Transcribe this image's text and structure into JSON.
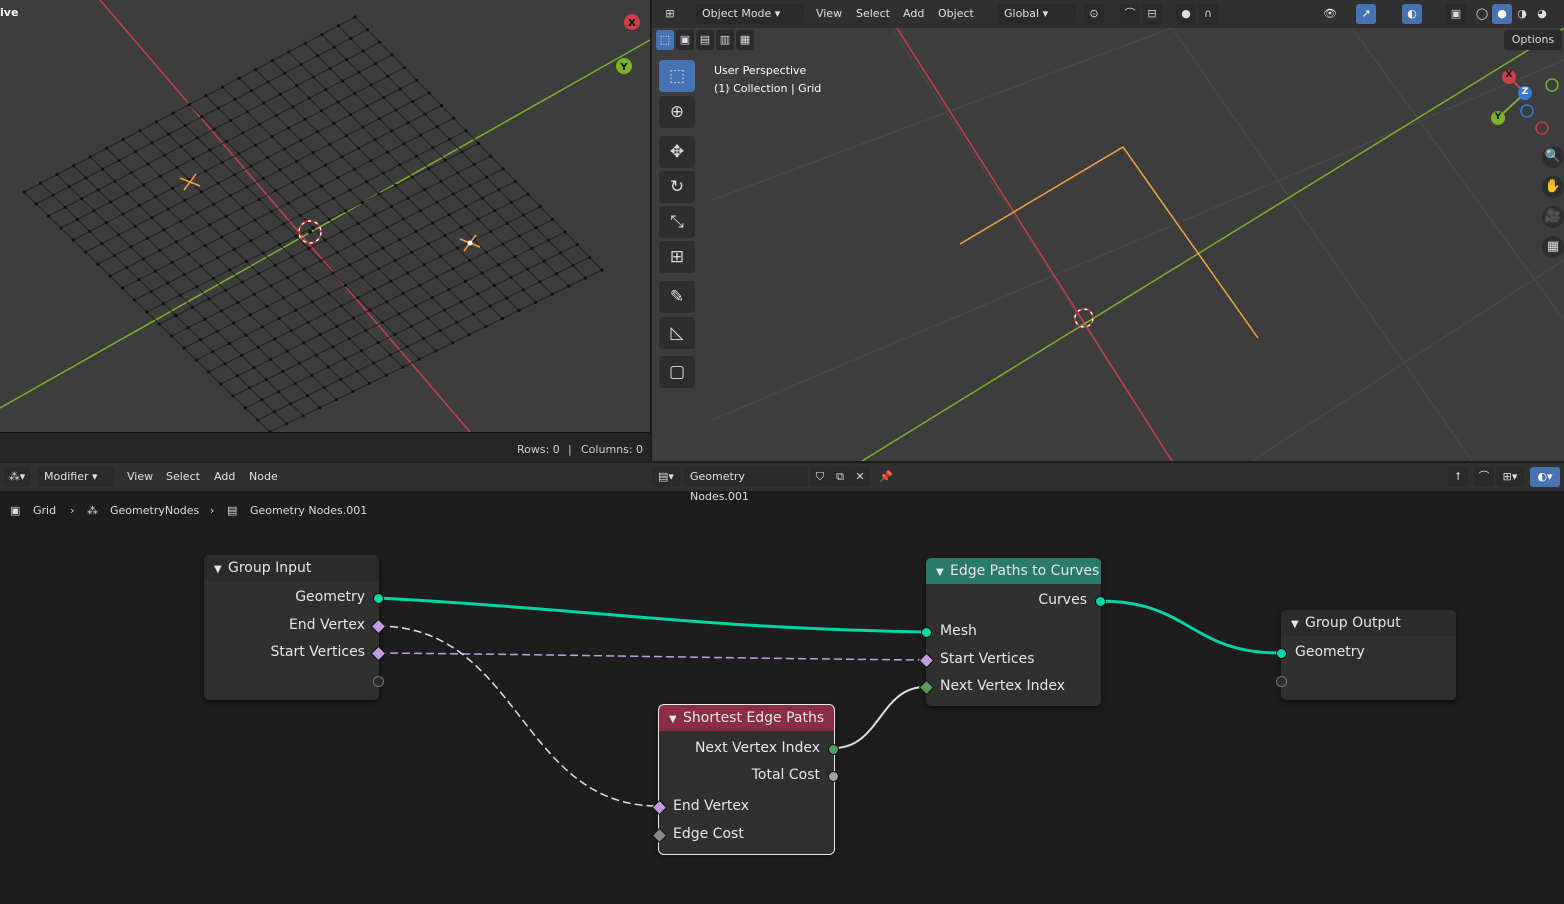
{
  "left_viewport": {
    "mode_label": "ive",
    "status": {
      "rows": "Rows: 0",
      "separator": "|",
      "columns": "Columns: 0"
    },
    "gizmo": {
      "x": "X",
      "y": "Y"
    }
  },
  "right_viewport": {
    "header": {
      "mode": "Object Mode",
      "menus": [
        "View",
        "Select",
        "Add",
        "Object"
      ],
      "orientation": "Global"
    },
    "overlay": {
      "line1": "User Perspective",
      "line2": "(1) Collection | Grid"
    },
    "options_label": "Options",
    "gizmo": {
      "x": "X",
      "y": "Y",
      "z": "Z"
    },
    "colors": {
      "x_axis": "#c8404a",
      "y_axis": "#7ab22a",
      "curve": "#f2a33a"
    }
  },
  "node_editor": {
    "header": {
      "context": "Modifier",
      "menus": [
        "View",
        "Select",
        "Add",
        "Node"
      ],
      "tree_name": "Geometry Nodes.001"
    },
    "breadcrumbs": [
      "Grid",
      "GeometryNodes",
      "Geometry Nodes.001"
    ],
    "nodes": {
      "group_input": {
        "title": "Group Input",
        "outputs": [
          "Geometry",
          "End Vertex",
          "Start Vertices"
        ]
      },
      "edge_paths": {
        "title": "Edge Paths to Curves",
        "outputs": [
          "Curves"
        ],
        "inputs": [
          "Mesh",
          "Start Vertices",
          "Next Vertex Index"
        ],
        "color": "#2a7a6a"
      },
      "group_output": {
        "title": "Group Output",
        "inputs": [
          "Geometry"
        ]
      },
      "shortest": {
        "title": "Shortest Edge Paths",
        "outputs": [
          "Next Vertex Index",
          "Total Cost"
        ],
        "inputs": [
          "End Vertex",
          "Edge Cost"
        ],
        "color": "#8a2e45"
      }
    },
    "colors": {
      "geometry_link": "#00d6a3",
      "field_link": "#d9d9d9",
      "bool_link": "#c59be0"
    }
  }
}
